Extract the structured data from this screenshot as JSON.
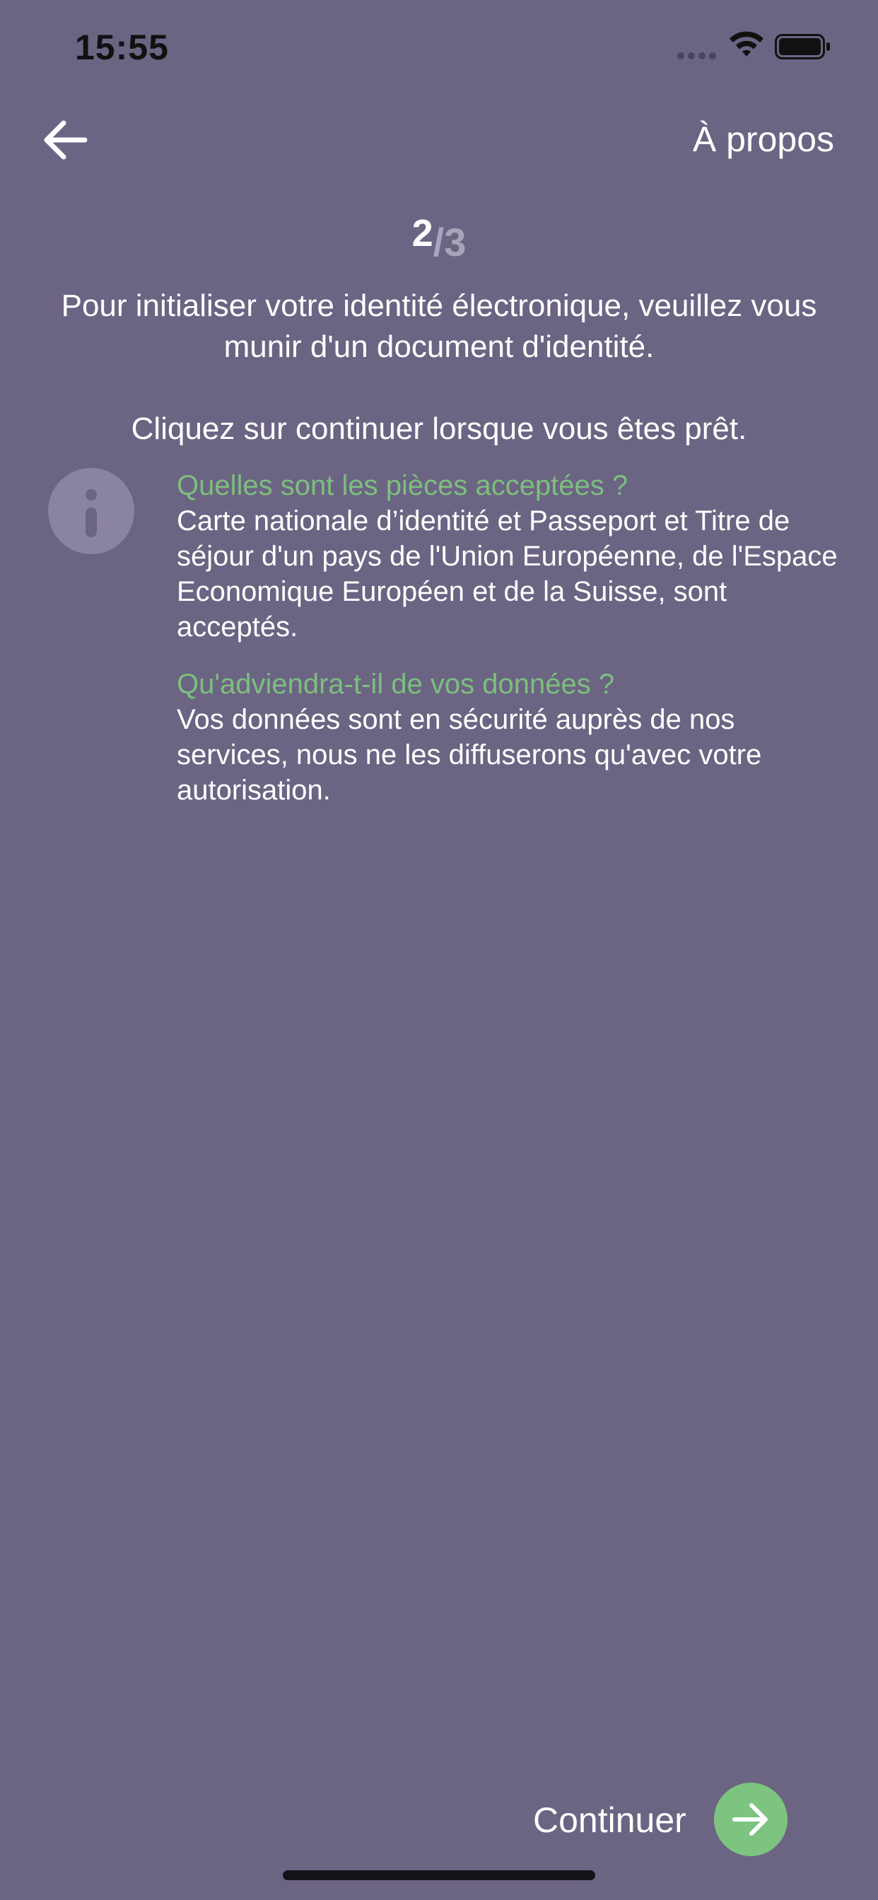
{
  "status_bar": {
    "time": "15:55",
    "signal_icon": "signal-dots-icon",
    "wifi_icon": "wifi-icon",
    "battery_icon": "battery-icon"
  },
  "nav": {
    "back_icon": "arrow-left-icon",
    "about_label": "À propos"
  },
  "step": {
    "current": "2",
    "total": "/3"
  },
  "intro": {
    "text": "Pour initialiser votre identité électronique, veuillez vous munir d'un document d'identité.",
    "instruction": "Cliquez sur continuer lorsque vous êtes prêt."
  },
  "info": {
    "icon": "info-icon",
    "sections": [
      {
        "question": "Quelles sont les pièces acceptées ?",
        "answer": "Carte nationale d’identité et Passeport et Titre de séjour d'un pays de l'Union Européenne, de l'Espace Economique Européen et de la Suisse, sont acceptés."
      },
      {
        "question": "Qu'adviendra-t-il de vos données ?",
        "answer": "Vos données sont en sécurité auprès de nos services, nous ne les diffuserons qu'avec votre autorisation."
      }
    ]
  },
  "footer": {
    "continue_label": "Continuer",
    "continue_icon": "arrow-right-icon"
  },
  "colors": {
    "background": "#6c6483",
    "accent_green": "#7cc47f",
    "question_green": "#7cbf7e",
    "info_circle": "#8b84a0"
  }
}
